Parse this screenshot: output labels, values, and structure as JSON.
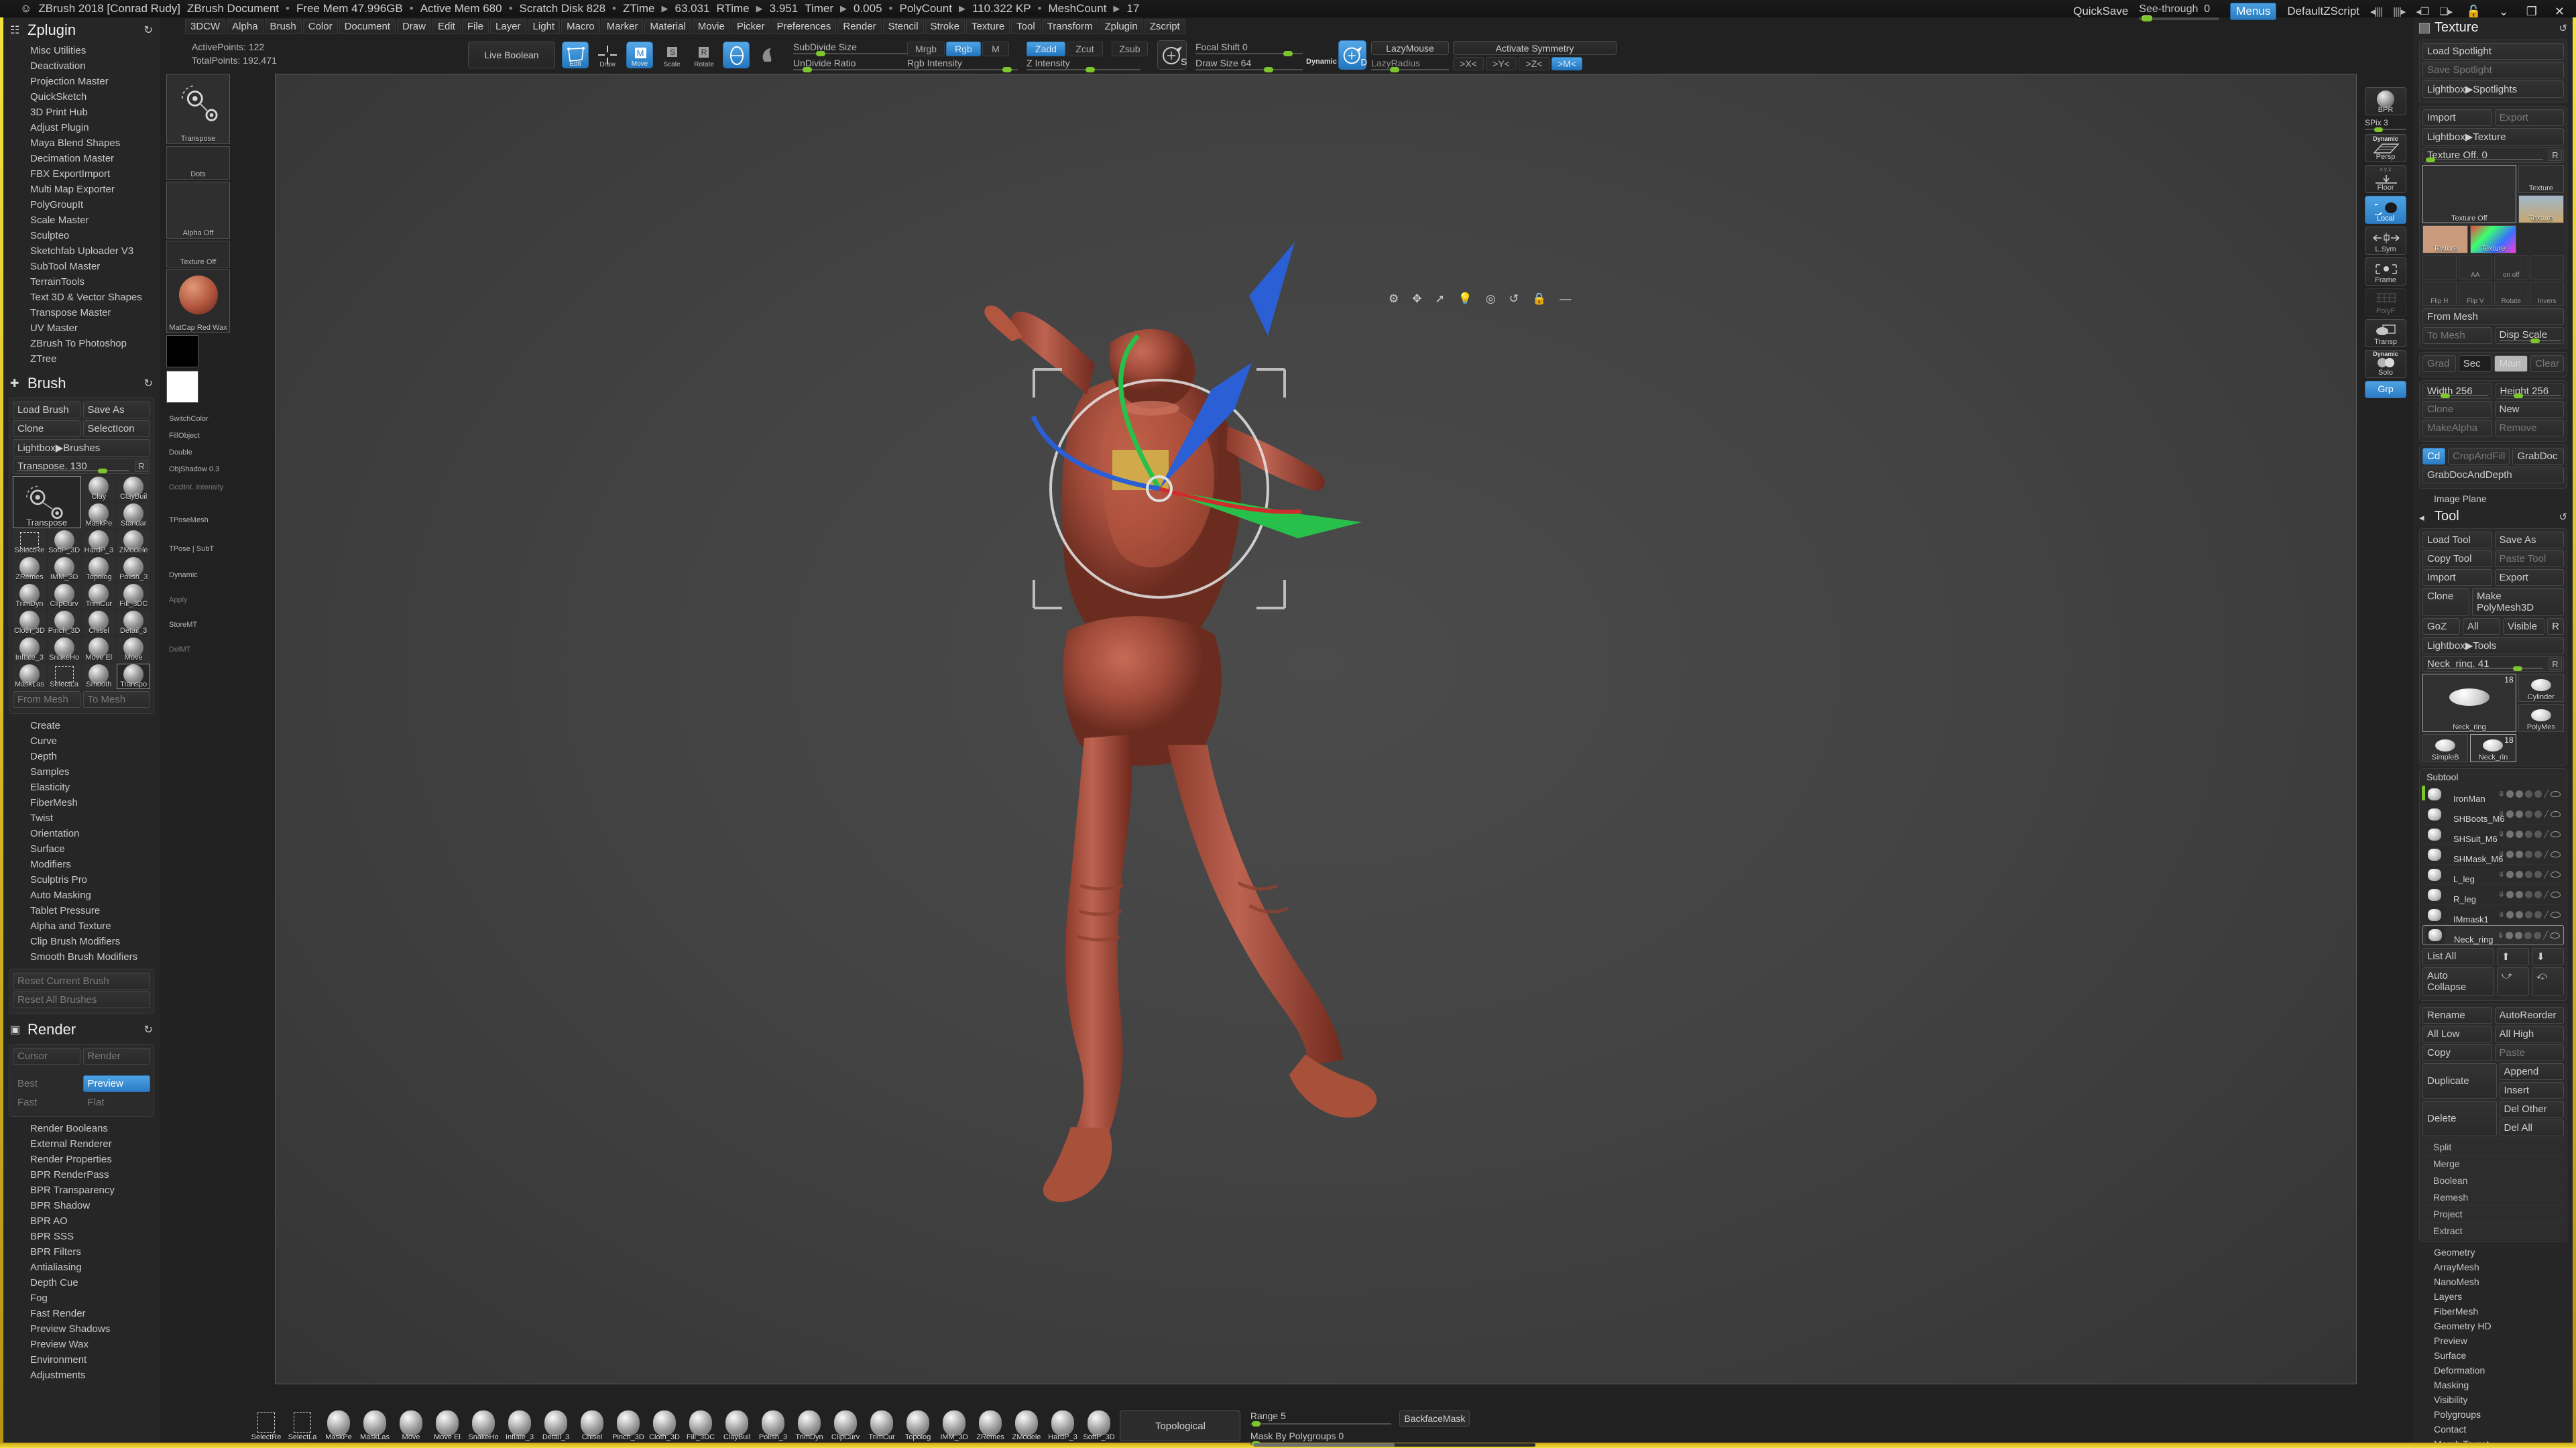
{
  "titlebar": {
    "app": "ZBrush 2018 [Conrad Rudy]",
    "document": "ZBrush Document",
    "free_mem": "Free Mem 47.996GB",
    "active_mem": "Active Mem 680",
    "scratch_disk": "Scratch Disk 828",
    "ztime_label": "ZTime",
    "ztime": "63.031",
    "rtime_label": "RTime",
    "rtime": "3.951",
    "timer_label": "Timer",
    "timer": "0.005",
    "polycount_label": "PolyCount",
    "polycount": "110.322 KP",
    "meshcount_label": "MeshCount",
    "meshcount": "17",
    "quicksave": "QuickSave",
    "seethrough_label": "See-through",
    "seethrough_value": "0",
    "menus": "Menus",
    "zscript": "DefaultZScript",
    "lock_icon": "lock-icon",
    "minimize_icon": "minimize-icon",
    "restore_icon": "restore-icon",
    "close_icon": "close-icon"
  },
  "menubar": {
    "items": [
      "3DCW",
      "Alpha",
      "Brush",
      "Color",
      "Document",
      "Draw",
      "Edit",
      "File",
      "Layer",
      "Light",
      "Macro",
      "Marker",
      "Material",
      "Movie",
      "Picker",
      "Preferences",
      "Render",
      "Stencil",
      "Stroke",
      "Texture",
      "Tool",
      "Transform",
      "Zplugin",
      "Zscript"
    ]
  },
  "toolbar": {
    "active_points": "ActivePoints: 122",
    "total_points": "TotalPoints: 192,471",
    "live_boolean": "Live Boolean",
    "edit": "Edit",
    "draw": "Draw",
    "move": "Move",
    "scale": "Scale",
    "rotate": "Rotate",
    "subdivide_size": "SubDivide Size",
    "undivide_ratio": "UnDivide Ratio",
    "mrgb": "Mrgb",
    "rgb": "Rgb",
    "m": "M",
    "zadd": "Zadd",
    "zcut": "Zcut",
    "zsub": "Zsub",
    "rgb_intensity": "Rgb Intensity",
    "z_intensity": "Z Intensity",
    "focal_shift": "Focal Shift 0",
    "draw_size": "Draw Size 64",
    "dynamic": "Dynamic",
    "lazymouse": "LazyMouse",
    "activate_symmetry": "Activate Symmetry",
    "lazyradius": "LazyRadius",
    "sym_x": ">X<",
    "sym_y": ">Y<",
    "sym_z": ">Z<",
    "sym_m": ">M<"
  },
  "leftpanel": {
    "zplugin": {
      "title": "Zplugin",
      "items": [
        "Misc Utilities",
        "Deactivation",
        "Projection Master",
        "QuickSketch",
        "3D Print Hub",
        "Adjust Plugin",
        "Maya Blend Shapes",
        "Decimation Master",
        "FBX ExportImport",
        "Multi Map Exporter",
        "PolyGroupIt",
        "Scale Master",
        "Sculpteo",
        "Sketchfab Uploader V3",
        "SubTool Master",
        "TerrainTools",
        "Text 3D & Vector Shapes",
        "Transpose Master",
        "UV Master",
        "ZBrush To Photoshop",
        "ZTree"
      ]
    },
    "brush": {
      "title": "Brush",
      "load_brush": "Load Brush",
      "save_as": "Save As",
      "clone": "Clone",
      "select_icon": "SelectIcon",
      "lightbox_brushes": "Lightbox▶Brushes",
      "slider_label": "Transpose.",
      "slider_value": "130",
      "reset_letter": "R",
      "swatches": [
        {
          "name": "Transpose",
          "big": true,
          "selected": true
        },
        {
          "name": "Clay"
        },
        {
          "name": "ClayBuil"
        },
        {
          "name": "MaskPe"
        },
        {
          "name": "Standar"
        },
        {
          "name": "SelectRe"
        },
        {
          "name": "SoftP_3D"
        },
        {
          "name": "HardP_3"
        },
        {
          "name": "ZModele"
        },
        {
          "name": "ZRemes"
        },
        {
          "name": "IMM_3D"
        },
        {
          "name": "Topolog"
        },
        {
          "name": "Polish_3"
        },
        {
          "name": "TrimDyn"
        },
        {
          "name": "ClipCurv"
        },
        {
          "name": "TrimCur"
        },
        {
          "name": "Fill_3DC"
        },
        {
          "name": "Cloth_3D"
        },
        {
          "name": "Pinch_3D"
        },
        {
          "name": "Chisel"
        },
        {
          "name": "Detail_3"
        },
        {
          "name": "Inflate_3"
        },
        {
          "name": "SnakeHo"
        },
        {
          "name": "Move El"
        },
        {
          "name": "Move"
        },
        {
          "name": "MaskLas"
        },
        {
          "name": "SelectLa"
        },
        {
          "name": "Smooth"
        },
        {
          "name": "Transpo",
          "selected": true
        }
      ],
      "from_mesh": "From Mesh",
      "to_mesh": "To Mesh",
      "sections": [
        "Create",
        "Curve",
        "Depth",
        "Samples",
        "Elasticity",
        "FiberMesh",
        "Twist",
        "Orientation",
        "Surface",
        "Modifiers",
        "Sculptris Pro",
        "Auto Masking",
        "Tablet Pressure",
        "Alpha and Texture",
        "Clip Brush Modifiers",
        "Smooth Brush Modifiers"
      ],
      "reset_current": "Reset Current Brush",
      "reset_all": "Reset All Brushes"
    },
    "render": {
      "title": "Render",
      "cursor": "Cursor",
      "render": "Render",
      "best": "Best",
      "preview": "Preview",
      "fast": "Fast",
      "flat": "Flat",
      "items": [
        "Render Booleans",
        "External Renderer",
        "Render Properties",
        "BPR RenderPass",
        "BPR Transparency",
        "BPR Shadow",
        "BPR AO",
        "BPR SSS",
        "BPR Filters",
        "Antialiasing",
        "Depth Cue",
        "Fog",
        "Fast Render",
        "Preview Shadows",
        "Preview Wax",
        "Environment",
        "Adjustments"
      ]
    }
  },
  "leftstrip": {
    "tool_label": "Transpose",
    "stroke_label": "Dots",
    "alpha_label": "Alpha Off",
    "texture_label": "Texture Off",
    "material_label": "MatCap Red Wax",
    "switch_color": "SwitchColor",
    "fill_object": "FillObject",
    "double": "Double",
    "obj_shadow": "ObjShadow 0.3",
    "occ_intensity": "OcclInt. Intensity",
    "tpose_mesh": "TPoseMesh",
    "tpose_subt": "TPose | SubT",
    "dynamic": "Dynamic",
    "apply": "Apply",
    "store_mt": "StoreMT",
    "del_mt": "DelMT"
  },
  "rightstrip": {
    "bpr": "BPR",
    "spix_label": "SPix",
    "spix_value": "3",
    "dynamic": "Dynamic",
    "persp": "Persp",
    "floor": "Floor",
    "local": "Local",
    "lsym": "L.Sym",
    "frame": "Frame",
    "polyf": "PolyF",
    "transp": "Transp",
    "solo": "Solo",
    "grp": "Grp"
  },
  "rightpanel": {
    "texture": {
      "title": "Texture",
      "load_spotlight": "Load Spotlight",
      "save_spotlight": "Save Spotlight",
      "lightbox_spotlights": "Lightbox▶Spotlights",
      "import": "Import",
      "export": "Export",
      "lightbox_texture": "Lightbox▶Texture",
      "offset_label": "Texture Off.",
      "offset_value": "0",
      "reset_letter": "R",
      "swatches": [
        {
          "name": "Texture Off",
          "big": true,
          "selected": true
        },
        {
          "name": "Texture"
        },
        {
          "name": "Texture"
        },
        {
          "name": "Texture"
        },
        {
          "name": "Texture"
        }
      ],
      "icons": [
        "blur-icon",
        "aa-icon",
        "on-off-icon",
        "gradient-icon",
        "flip-h-icon",
        "flip-v-icon",
        "rotate-icon",
        "invert-icon"
      ],
      "icon_labels": [
        "",
        "AA",
        "on off",
        "",
        "Flip H",
        "Flip V",
        "Rotate",
        "Invers"
      ],
      "from_mesh": "From Mesh",
      "to_mesh": "To Mesh",
      "disp_scale": "Disp Scale",
      "grad": "Grad",
      "sec": "Sec",
      "main": "Main",
      "clear": "Clear",
      "width_label": "Width 256",
      "height_label": "Height 256",
      "clone": "Clone",
      "new": "New",
      "make_alpha": "MakeAlpha",
      "remove": "Remove",
      "cd": "Cd",
      "crop_and_fill": "CropAndFill",
      "grab_doc": "GrabDoc",
      "grab_doc_and_depth": "GrabDocAndDepth",
      "image_plane": "Image Plane"
    },
    "tool": {
      "title": "Tool",
      "load_tool": "Load Tool",
      "save_as": "Save As",
      "copy_tool": "Copy Tool",
      "paste_tool": "Paste Tool",
      "import": "Import",
      "export": "Export",
      "clone": "Clone",
      "make_polymesh": "Make PolyMesh3D",
      "goz": "GoZ",
      "all": "All",
      "visible": "Visible",
      "reset_letter": "R",
      "lightbox_tools": "Lightbox▶Tools",
      "slider_label": "Neck_ring.",
      "slider_value": "41",
      "swatches": [
        {
          "name": "Neck_ring",
          "badge": "18",
          "big": true,
          "selected": true
        },
        {
          "name": "Cylinder"
        },
        {
          "name": "PolyMes"
        },
        {
          "name": "SimpleB"
        },
        {
          "name": "Neck_rin",
          "badge": "18",
          "selected": true
        }
      ],
      "subtool_title": "Subtool",
      "subtools": [
        {
          "name": "IronMan",
          "selected": false,
          "active_marker": true
        },
        {
          "name": "SHBoots_M6"
        },
        {
          "name": "SHSuit_M6"
        },
        {
          "name": "SHMask_M6"
        },
        {
          "name": "L_leg"
        },
        {
          "name": "R_leg"
        },
        {
          "name": "IMmask1"
        },
        {
          "name": "Neck_ring",
          "selected": true
        }
      ],
      "list_all": "List All",
      "auto_collapse": "Auto Collapse",
      "rename": "Rename",
      "auto_reorder": "AutoReorder",
      "all_low": "All Low",
      "all_high": "All High",
      "copy": "Copy",
      "paste": "Paste",
      "duplicate": "Duplicate",
      "append": "Append",
      "insert": "Insert",
      "delete": "Delete",
      "del_other": "Del Other",
      "del_all": "Del All",
      "stripes": [
        "Split",
        "Merge",
        "Boolean",
        "Remesh",
        "Project",
        "Extract"
      ],
      "sections": [
        "Geometry",
        "ArrayMesh",
        "NanoMesh",
        "Layers",
        "FiberMesh",
        "Geometry HD",
        "Preview",
        "Surface",
        "Deformation",
        "Masking",
        "Visibility",
        "Polygroups",
        "Contact",
        "Morph Target"
      ]
    }
  },
  "bottombar": {
    "brushes": [
      "SelectRe",
      "SelectLa",
      "MaskPe",
      "MaskLas",
      "Move",
      "Move El",
      "SnakeHo",
      "Inflate_3",
      "Detail_3",
      "Chisel",
      "Pinch_3D",
      "Cloth_3D",
      "Fill_3DC",
      "ClayBuil",
      "Polish_3",
      "TrimDyn",
      "ClipCurv",
      "TrimCur",
      "Topolog",
      "IMM_3D",
      "ZRemes",
      "ZModele",
      "HardP_3",
      "SoftP_3D"
    ],
    "topological": "Topological",
    "range_label": "Range 5",
    "mask_by_polygroups": "Mask By Polygroups 0",
    "backface_mask": "BackfaceMask"
  },
  "colors": {
    "accent_yellow": "#f5e23c",
    "accent_blue": "#2a7cc4",
    "slider_green": "#7dc52c",
    "panel_bg": "#262626",
    "canvas_bg": "#454545",
    "model_red": "#a34437"
  }
}
